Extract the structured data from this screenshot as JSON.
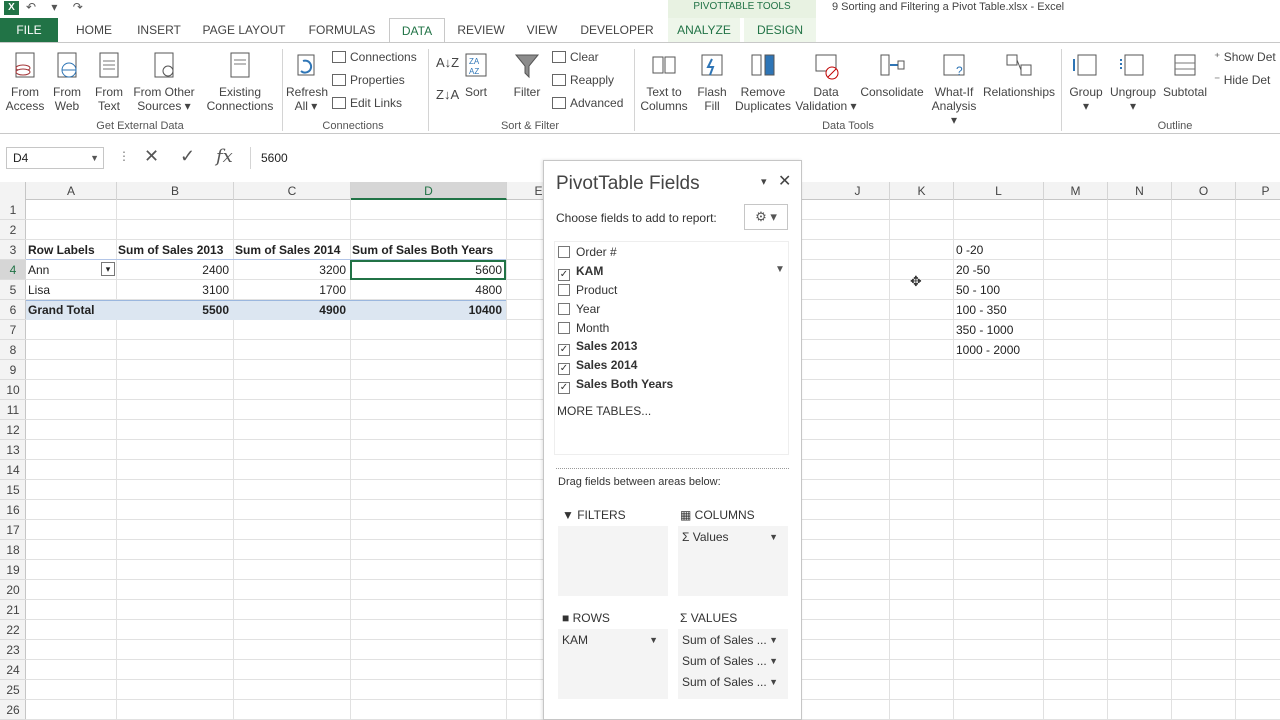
{
  "titlebar": {
    "logo": "X",
    "qat": "↶ ▾ ↷",
    "context_tools": "PIVOTTABLE TOOLS",
    "document_title": "9 Sorting and Filtering a Pivot Table.xlsx - Excel"
  },
  "tabs": [
    "FILE",
    "HOME",
    "INSERT",
    "PAGE LAYOUT",
    "FORMULAS",
    "DATA",
    "REVIEW",
    "VIEW",
    "DEVELOPER",
    "ANALYZE",
    "DESIGN"
  ],
  "ribbon": {
    "get_external": {
      "label": "Get External Data",
      "from_access": [
        "From",
        "Access"
      ],
      "from_web": [
        "From",
        "Web"
      ],
      "from_text": [
        "From",
        "Text"
      ],
      "from_other": [
        "From Other",
        "Sources ▾"
      ],
      "existing": [
        "Existing",
        "Connections"
      ]
    },
    "connections": {
      "label": "Connections",
      "refresh": [
        "Refresh",
        "All ▾"
      ],
      "connections": "Connections",
      "properties": "Properties",
      "edit_links": "Edit Links"
    },
    "sort_filter": {
      "label": "Sort & Filter",
      "sort": "Sort",
      "filter": "Filter",
      "clear": "Clear",
      "reapply": "Reapply",
      "advanced": "Advanced"
    },
    "data_tools": {
      "label": "Data Tools",
      "text_to_columns": [
        "Text to",
        "Columns"
      ],
      "flash_fill": [
        "Flash",
        "Fill"
      ],
      "remove_duplicates": [
        "Remove",
        "Duplicates"
      ],
      "data_validation": [
        "Data",
        "Validation ▾"
      ],
      "consolidate": "Consolidate",
      "what_if": [
        "What-If",
        "Analysis ▾"
      ],
      "relationships": "Relationships"
    },
    "outline": {
      "label": "Outline",
      "group": [
        "Group",
        "▾"
      ],
      "ungroup": [
        "Ungroup",
        "▾"
      ],
      "subtotal": "Subtotal",
      "show_detail": "Show Det",
      "hide_detail": "Hide Det"
    }
  },
  "formula_bar": {
    "namebox": "D4",
    "separator": "⋮",
    "cancel": "✕",
    "enter": "✓",
    "fx": "fx",
    "value": "5600"
  },
  "columns": [
    "A",
    "B",
    "C",
    "D",
    "E",
    "J",
    "K",
    "L",
    "M",
    "N",
    "O",
    "P"
  ],
  "rows": [
    "1",
    "2",
    "3",
    "4",
    "5",
    "6",
    "7",
    "8",
    "9",
    "10",
    "11",
    "12",
    "13",
    "14",
    "15",
    "16",
    "17",
    "18",
    "19",
    "20",
    "21",
    "22",
    "23",
    "24",
    "25",
    "26"
  ],
  "pivot": {
    "headers": [
      "Row Labels",
      "Sum of Sales 2013",
      "Sum of Sales 2014",
      "Sum of Sales Both Years"
    ],
    "rows": [
      {
        "label": "Ann",
        "s2013": "2400",
        "s2014": "3200",
        "both": "5600"
      },
      {
        "label": "Lisa",
        "s2013": "3100",
        "s2014": "1700",
        "both": "4800"
      }
    ],
    "grand_total": {
      "label": "Grand Total",
      "s2013": "5500",
      "s2014": "4900",
      "both": "10400"
    }
  },
  "ranges": [
    "0 -20",
    "20 -50",
    "50 - 100",
    "100 - 350",
    "350 - 1000",
    "1000 - 2000"
  ],
  "pivot_pane": {
    "title": "PivotTable Fields",
    "menu": "▾",
    "close": "✕",
    "choose": "Choose fields to add to report:",
    "gear": "⚙ ▾",
    "fields": [
      {
        "name": "Order #",
        "checked": false
      },
      {
        "name": "KAM",
        "checked": true
      },
      {
        "name": "Product",
        "checked": false
      },
      {
        "name": "Year",
        "checked": false
      },
      {
        "name": "Month",
        "checked": false
      },
      {
        "name": "Sales 2013",
        "checked": true
      },
      {
        "name": "Sales 2014",
        "checked": true
      },
      {
        "name": "Sales Both Years",
        "checked": true
      }
    ],
    "more_tables": "MORE TABLES...",
    "drag_label": "Drag fields between areas below:",
    "filters_label": "FILTERS",
    "columns_label": "COLUMNS",
    "rows_label": "ROWS",
    "values_label": "VALUES",
    "columns_items": [
      "Σ Values"
    ],
    "rows_items": [
      "KAM"
    ],
    "values_items": [
      "Sum of Sales ...",
      "Sum of Sales ...",
      "Sum of Sales ..."
    ]
  }
}
